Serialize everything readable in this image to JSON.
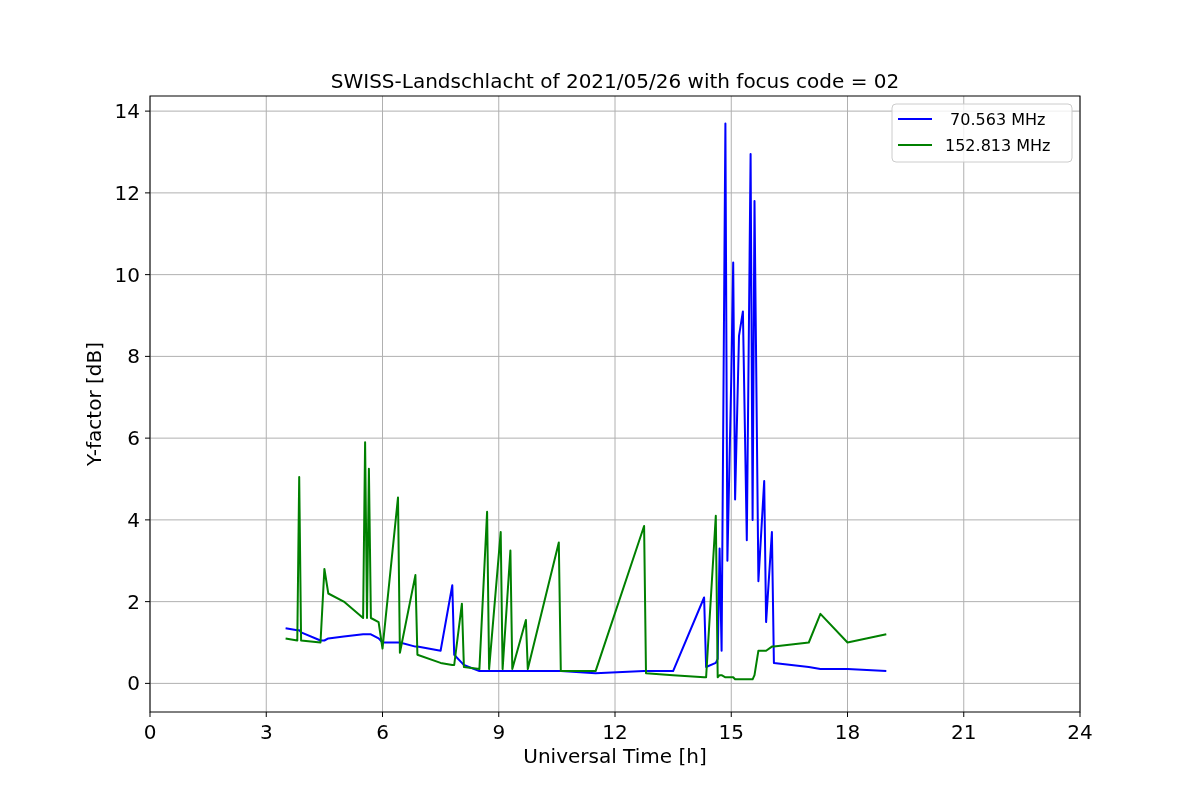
{
  "figure": {
    "chart_data": {
      "type": "line",
      "title": "SWISS-Landschlacht of 2021/05/26 with focus code = 02",
      "xlabel": "Universal Time [h]",
      "ylabel": "Y-factor [dB]",
      "x": [
        3.5,
        3.8,
        3.85,
        3.9,
        4.4,
        4.5,
        4.6,
        5.0,
        5.5,
        5.55,
        5.6,
        5.65,
        5.7,
        5.9,
        6.0,
        6.4,
        6.45,
        6.85,
        6.9,
        7.5,
        7.8,
        7.85,
        8.05,
        8.1,
        8.5,
        8.7,
        8.75,
        9.05,
        9.1,
        9.3,
        9.35,
        9.7,
        9.75,
        10.55,
        10.6,
        11.5,
        12.75,
        12.8,
        13.5,
        14.3,
        14.35,
        14.6,
        14.65,
        14.7,
        14.75,
        14.85,
        14.9,
        15.0,
        15.05,
        15.1,
        15.2,
        15.3,
        15.4,
        15.5,
        15.55,
        15.6,
        15.7,
        15.85,
        15.9,
        16.05,
        16.1,
        17.0,
        17.3,
        18.0,
        19.0
      ],
      "series": [
        {
          "name": " 70.563 MHz",
          "color": "#0000ff",
          "values": [
            1.35,
            1.3,
            1.3,
            1.25,
            1.05,
            1.05,
            1.1,
            1.15,
            1.2,
            1.2,
            1.2,
            1.2,
            1.2,
            1.1,
            1.0,
            1.0,
            1.0,
            0.9,
            0.9,
            0.8,
            2.4,
            0.7,
            0.5,
            0.45,
            0.3,
            0.3,
            0.3,
            0.3,
            0.3,
            0.3,
            0.3,
            0.3,
            0.3,
            0.3,
            0.3,
            0.25,
            0.3,
            0.3,
            0.3,
            2.1,
            0.4,
            0.5,
            0.6,
            3.3,
            0.8,
            13.7,
            3.0,
            7.5,
            10.3,
            4.5,
            8.5,
            9.1,
            3.5,
            12.95,
            4.0,
            11.8,
            2.5,
            4.95,
            1.5,
            3.7,
            0.5,
            0.4,
            0.35,
            0.35,
            0.3
          ]
        },
        {
          "name": "152.813 MHz",
          "color": "#008000",
          "values": [
            1.1,
            1.05,
            5.05,
            1.05,
            1.0,
            2.8,
            2.2,
            2.0,
            1.6,
            5.9,
            1.6,
            5.25,
            1.6,
            1.5,
            0.85,
            4.55,
            0.75,
            2.65,
            0.7,
            0.5,
            0.45,
            0.45,
            1.95,
            0.4,
            0.35,
            4.2,
            0.35,
            3.7,
            0.35,
            3.25,
            0.35,
            1.55,
            0.35,
            3.45,
            0.3,
            0.3,
            3.85,
            0.25,
            0.2,
            0.15,
            0.15,
            4.1,
            0.15,
            0.2,
            0.2,
            0.15,
            0.15,
            0.15,
            0.15,
            0.1,
            0.1,
            0.1,
            0.1,
            0.1,
            0.1,
            0.2,
            0.8,
            0.8,
            0.8,
            0.9,
            0.9,
            1.0,
            1.7,
            1.0,
            1.2
          ]
        }
      ],
      "grid": true,
      "legend": true,
      "xlim": [
        0,
        24
      ],
      "ylim": [
        -0.7,
        14.37
      ],
      "xticks": [
        0,
        3,
        6,
        9,
        12,
        15,
        18,
        21,
        24
      ],
      "yticks": [
        0,
        2,
        4,
        6,
        8,
        10,
        12,
        14
      ]
    }
  }
}
